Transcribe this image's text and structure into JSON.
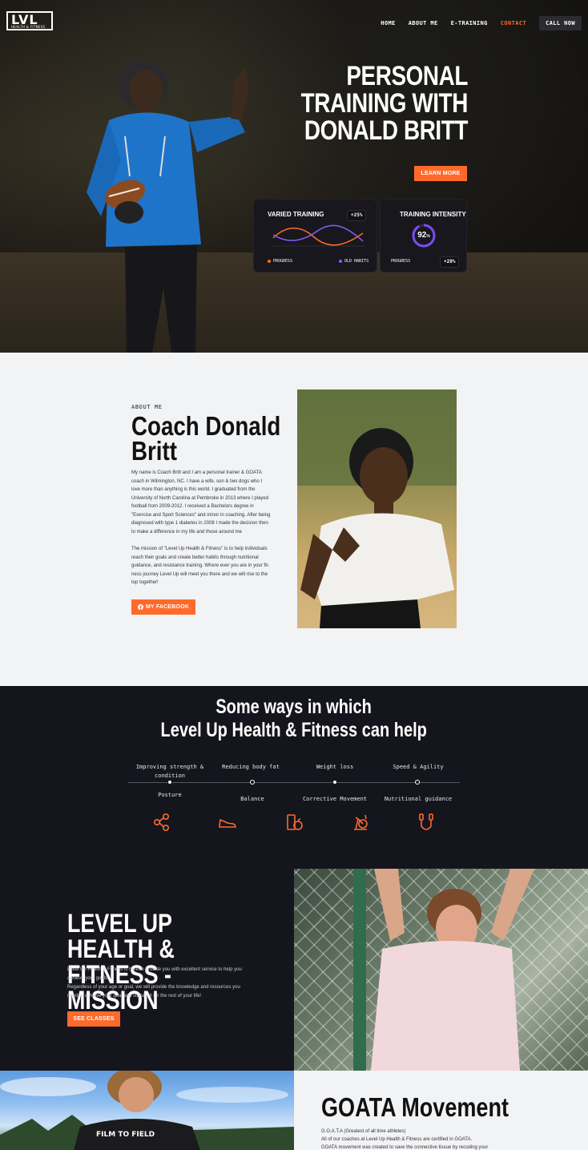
{
  "header": {
    "logo": {
      "mark": "LVL",
      "tagline": "HEALTH & FITNESS"
    },
    "nav": [
      {
        "label": "HOME"
      },
      {
        "label": "ABOUT ME"
      },
      {
        "label": "E-TRAINING"
      },
      {
        "label": "CONTACT",
        "active": true
      },
      {
        "label": "CALL NOW"
      }
    ]
  },
  "hero": {
    "title_lines": [
      "PERSONAL",
      "TRAINING WITH",
      "DONALD BRITT"
    ],
    "cta": "LEARN MORE",
    "card1": {
      "title": "VARIED TRAINING",
      "chip": "+25%",
      "legend": [
        "PROGRESS",
        "OLD HABITS"
      ]
    },
    "card2": {
      "title": "TRAINING INTENSITY",
      "gauge": "92",
      "gauge_unit": "%",
      "gauge_fraction": 0.92,
      "legend": "PROGRESS",
      "chip": "+20%"
    }
  },
  "about": {
    "kicker": "ABOUT ME",
    "title_lines": [
      "Coach Donald",
      "Britt"
    ],
    "para1_lines": [
      "My name is Coach Britt and I am a personal trainer & GOATA",
      "coach in Wilmington, NC. I have a wife, son & two dogs who I",
      "love more than anything is this world. I graduated from the",
      "University of North Carolina at Pembroke in 2013 where I played",
      "football from 2009-2012. I received a Bachelors degree in",
      "\"Exercise and Sport Sciences\" and minor in coaching. After being",
      "diagnosed with type 1 diabetes in 2008 I  made the decision then",
      "to make a difference in my life and those around me"
    ],
    "para2_lines": [
      "The mission of \"Level Up Health & Fitness\" is to help individuals",
      "reach their goals and create better habits through nutritional",
      "guidance, and resistance training. Where ever you are in your fit-",
      "ness journey Level Up will meet you there and we will rise to the",
      "top together!"
    ],
    "button": "MY FACEBOOK"
  },
  "ways": {
    "heading_lines": [
      "Some ways in which",
      "Level Up Health & Fitness can help"
    ],
    "top_labels": [
      "Improving strength &\ncondition",
      "Reducing body fat",
      "Weight loss",
      "Speed & Agility"
    ],
    "bottom_labels": [
      "Posture",
      "Balance",
      "Corrective Movement",
      "Nutritional guidance"
    ],
    "icons": [
      "molecule-icon",
      "shoe-icon",
      "nutrition-icon",
      "exercise-bike-icon",
      "jump-rope-icon"
    ],
    "accent": "#ff6a2b"
  },
  "mission": {
    "title_lines": [
      "LEVEL UP HEALTH &",
      "FITNESS - MISSION"
    ],
    "lines": [
      "Level Up Health & Fitness is here to provide you with excellent service to help you",
      "achieve your goals.",
      "Regardless of your age or goal, we will provide the knowledge and resources you",
      "need to achieve your goal and sustain it for the rest of your life!"
    ],
    "button": "SEE CLASSES"
  },
  "goata": {
    "title": "GOATA Movement",
    "lines": [
      "G.O.A.T.A (Greatest of all time athletes)",
      "All of our coaches at Level Up Health & Fitness are certified in GOATA.",
      "GOATA movement was created to save the connective tissue by recoding your"
    ],
    "shirt_text": "FILM TO FIELD"
  }
}
